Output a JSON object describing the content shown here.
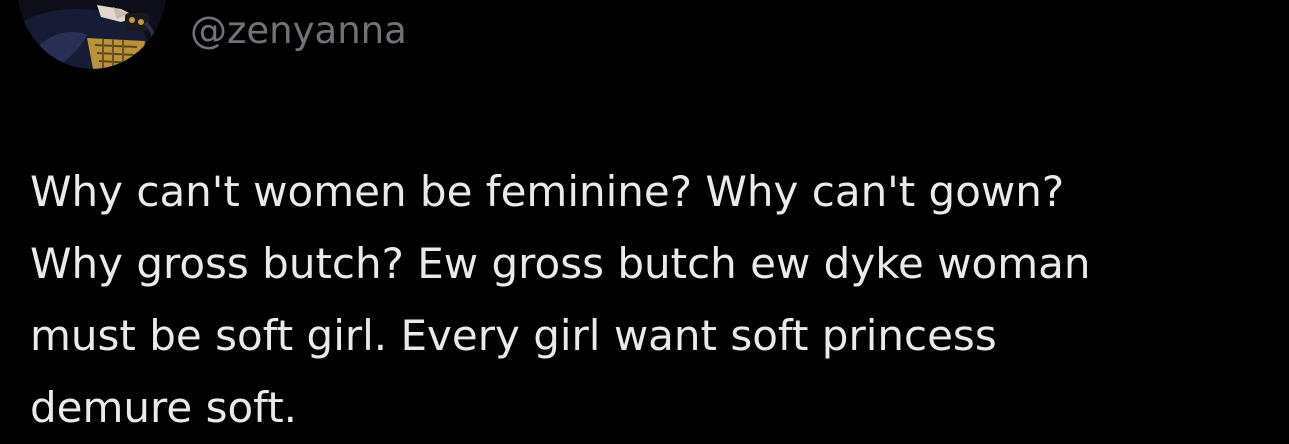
{
  "tweet": {
    "handle": "@zenyanna",
    "text_lines": [
      "Why can't women be feminine? Why can't gown?",
      "Why gross butch? Ew gross butch ew dyke woman",
      "must be soft girl. Every girl want soft princess",
      "demure soft."
    ]
  },
  "colors": {
    "background": "#000000",
    "text": "#e8eaeb",
    "handle": "#6f7377"
  }
}
